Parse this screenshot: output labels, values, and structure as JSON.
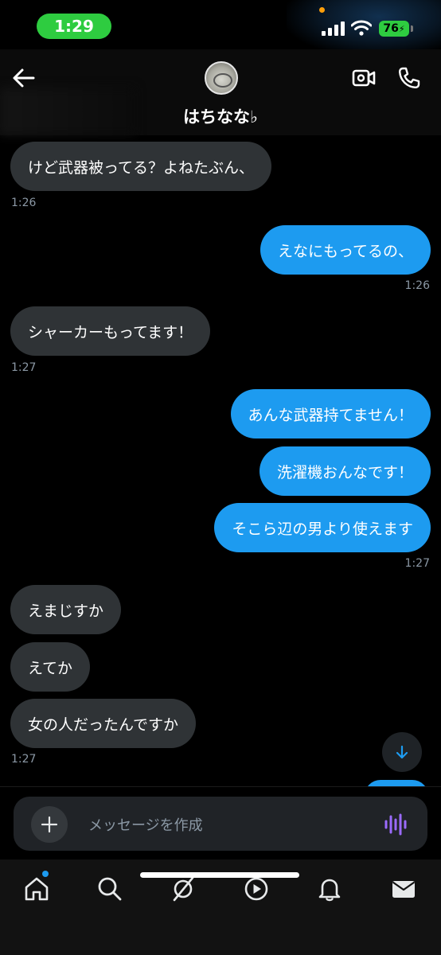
{
  "status_bar": {
    "time": "1:29",
    "battery": "76"
  },
  "header": {
    "contact_name": "はちなな♭"
  },
  "messages": [
    {
      "text": "けど武器被ってる？よねたぶん、",
      "time": "1:26"
    },
    {
      "text": "えなにもってるの、",
      "time": "1:26"
    },
    {
      "text": "シャーカーもってます！",
      "time": "1:27"
    },
    {
      "text": "あんな武器持てません！"
    },
    {
      "text": "洗濯機おんなです！"
    },
    {
      "text": "そこら辺の男より使えます",
      "time": "1:27"
    },
    {
      "text": "えまじすか"
    },
    {
      "text": "えてか"
    },
    {
      "text": "女の人だったんですか",
      "time": "1:27"
    }
  ],
  "composer": {
    "placeholder": "メッセージを作成"
  },
  "colors": {
    "accent": "#1d9bf0",
    "incoming_bubble": "#2f3336",
    "status_green": "#2ecc40",
    "voice_purple": "#9b6bff"
  },
  "icons": {
    "back": "arrow-left-icon",
    "video": "video-camera-icon",
    "call": "phone-icon",
    "add": "plus-icon",
    "voice": "waveform-icon",
    "scroll": "arrow-down-icon",
    "tabs": [
      "home-icon",
      "search-icon",
      "grok-icon",
      "play-icon",
      "bell-icon",
      "mail-icon"
    ]
  }
}
